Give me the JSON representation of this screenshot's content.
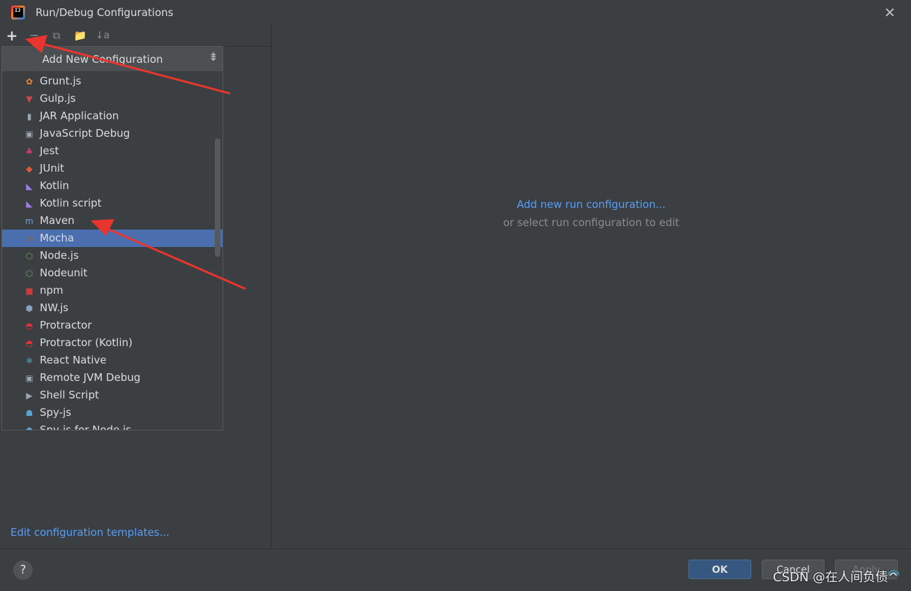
{
  "window": {
    "title": "Run/Debug Configurations",
    "close_glyph": "✕",
    "app_icon_text": "IJ"
  },
  "toolbar": {
    "add": "+",
    "remove": "−",
    "copy": "⧉",
    "folder": "📁",
    "sort": "↓a"
  },
  "popup": {
    "title": "Add New Configuration",
    "collapse_glyph": "⇟",
    "items": [
      {
        "label": "Grunt.js",
        "icon": "grunt-icon",
        "glyph": "✿",
        "color": "#e48632"
      },
      {
        "label": "Gulp.js",
        "icon": "gulp-icon",
        "glyph": "▼",
        "color": "#cf4647"
      },
      {
        "label": "JAR Application",
        "icon": "jar-icon",
        "glyph": "▮",
        "color": "#9aa7b0"
      },
      {
        "label": "JavaScript Debug",
        "icon": "javascript-debug-icon",
        "glyph": "▣",
        "color": "#9aa7b0"
      },
      {
        "label": "Jest",
        "icon": "jest-icon",
        "glyph": "♣",
        "color": "#c63d6d"
      },
      {
        "label": "JUnit",
        "icon": "junit-icon",
        "glyph": "◆",
        "color": "#db5c36"
      },
      {
        "label": "Kotlin",
        "icon": "kotlin-icon",
        "glyph": "◣",
        "color": "#a17bf0"
      },
      {
        "label": "Kotlin script",
        "icon": "kotlin-script-icon",
        "glyph": "◣",
        "color": "#a17bf0"
      },
      {
        "label": "Maven",
        "icon": "maven-icon",
        "glyph": "m",
        "color": "#6ea3d8"
      },
      {
        "label": "Mocha",
        "icon": "mocha-icon",
        "glyph": "m",
        "color": "#8d6748"
      },
      {
        "label": "Node.js",
        "icon": "nodejs-icon",
        "glyph": "⬡",
        "color": "#6da55f"
      },
      {
        "label": "Nodeunit",
        "icon": "nodeunit-icon",
        "glyph": "⬡",
        "color": "#6da55f"
      },
      {
        "label": "npm",
        "icon": "npm-icon",
        "glyph": "■",
        "color": "#c73d3d"
      },
      {
        "label": "NW.js",
        "icon": "nwjs-icon",
        "glyph": "⬢",
        "color": "#8aa0c0"
      },
      {
        "label": "Protractor",
        "icon": "protractor-icon",
        "glyph": "◓",
        "color": "#e23237"
      },
      {
        "label": "Protractor (Kotlin)",
        "icon": "protractor-kotlin-icon",
        "glyph": "◓",
        "color": "#e23237"
      },
      {
        "label": "React Native",
        "icon": "react-native-icon",
        "glyph": "⚛",
        "color": "#61dafb"
      },
      {
        "label": "Remote JVM Debug",
        "icon": "remote-jvm-debug-icon",
        "glyph": "▣",
        "color": "#9aa7b0"
      },
      {
        "label": "Shell Script",
        "icon": "shell-script-icon",
        "glyph": "▶",
        "color": "#9aa7b0"
      },
      {
        "label": "Spy-js",
        "icon": "spy-js-icon",
        "glyph": "☗",
        "color": "#5aa2d6"
      },
      {
        "label": "Spy-js for Node.js",
        "icon": "spy-js-node-icon",
        "glyph": "☗",
        "color": "#5aa2d6"
      }
    ],
    "selected_index": 9
  },
  "left": {
    "edit_templates": "Edit configuration templates..."
  },
  "right": {
    "add_link": "Add new run configuration...",
    "hint": "or select run configuration to edit"
  },
  "footer": {
    "help": "?",
    "ok": "OK",
    "cancel": "Cancel",
    "apply": "Apply",
    "watermark": "CSDN @在人间负债^",
    "watermark_glyph": "︽"
  },
  "colors": {
    "background": "#3c3f41",
    "selection": "#4b6eaf",
    "link": "#589df6",
    "annotation_arrow": "#e8352d"
  }
}
